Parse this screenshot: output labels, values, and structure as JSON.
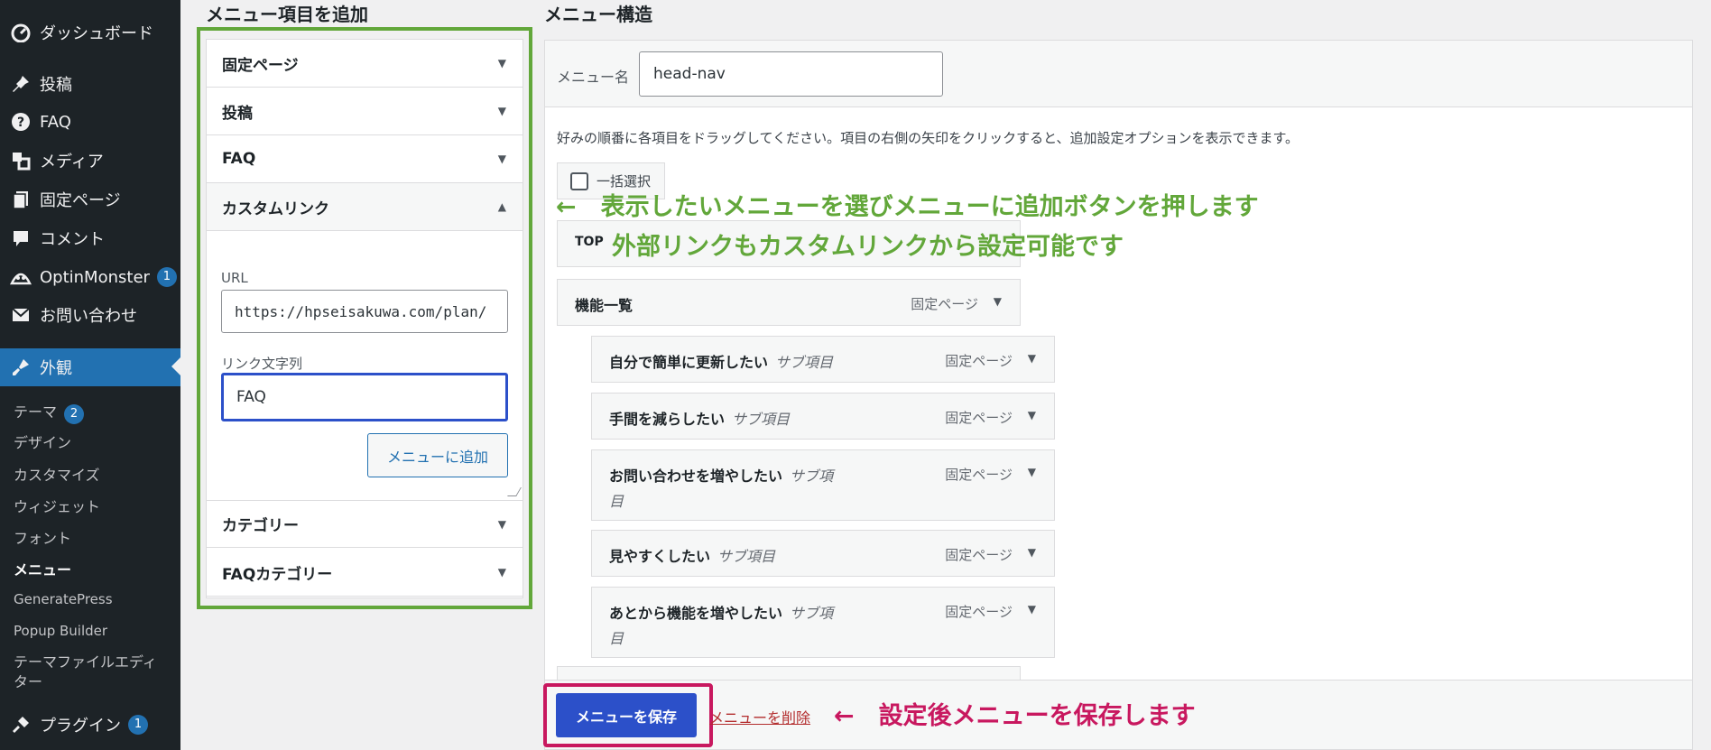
{
  "sidebar": {
    "items": [
      {
        "icon": "dashboard-icon",
        "label": "ダッシュボード"
      },
      {
        "icon": "pin-icon",
        "label": "投稿"
      },
      {
        "icon": "question-icon",
        "label": "FAQ"
      },
      {
        "icon": "media-icon",
        "label": "メディア"
      },
      {
        "icon": "page-icon",
        "label": "固定ページ"
      },
      {
        "icon": "comment-icon",
        "label": "コメント"
      },
      {
        "icon": "optinmonster-icon",
        "label": "OptinMonster",
        "badge": "1"
      },
      {
        "icon": "mail-icon",
        "label": "お問い合わせ"
      },
      {
        "icon": "appearance-icon",
        "label": "外観"
      },
      {
        "icon": "plugin-icon",
        "label": "プラグイン",
        "badge": "1"
      }
    ],
    "appearance_submenu": [
      {
        "label": "テーマ",
        "badge": "2"
      },
      {
        "label": "デザイン"
      },
      {
        "label": "カスタマイズ"
      },
      {
        "label": "ウィジェット"
      },
      {
        "label": "フォント"
      },
      {
        "label": "メニュー"
      },
      {
        "label": "GeneratePress"
      },
      {
        "label": "Popup Builder"
      },
      {
        "label": "テーマファイルエディター"
      }
    ],
    "colors": {
      "background": "#1d2327",
      "current": "#2271b1"
    }
  },
  "add_items": {
    "title": "メニュー項目を追加",
    "sections": [
      "固定ページ",
      "投稿",
      "FAQ",
      "カスタムリンク",
      "カテゴリー",
      "FAQカテゴリー"
    ],
    "custom_link": {
      "url_label": "URL",
      "url_value": "https://hpseisakuwa.com/plan/",
      "text_label": "リンク文字列",
      "text_value": "FAQ",
      "add_button": "メニューに追加"
    }
  },
  "menu_structure": {
    "title": "メニュー構造",
    "menu_name_label": "メニュー名",
    "menu_name_value": "head-nav",
    "instructions": "好みの順番に各項目をドラッグしてください。項目の右側の矢印をクリックすると、追加設定オプションを表示できます。",
    "bulk_select": "一括選択",
    "items": [
      {
        "title": "TOP",
        "sub": "",
        "type": ""
      },
      {
        "title": "機能一覧",
        "sub": "",
        "type": "固定ページ"
      },
      {
        "title": "自分で簡単に更新したい",
        "sub": "サブ項目",
        "type": "固定ページ"
      },
      {
        "title": "手間を減らしたい",
        "sub": "サブ項目",
        "type": "固定ページ"
      },
      {
        "title": "お問い合わせを増やしたい",
        "sub": "サブ項",
        "sub2": "目",
        "type": "固定ページ"
      },
      {
        "title": "見やすくしたい",
        "sub": "サブ項目",
        "type": "固定ページ"
      },
      {
        "title": "あとから機能を増やしたい",
        "sub": "サブ項",
        "sub2": "目",
        "type": "固定ページ"
      }
    ],
    "save_button": "メニューを保存",
    "delete_link": "メニューを削除"
  },
  "annotations": {
    "green_line1": "←　表示したいメニューを選びメニューに追加ボタンを押します",
    "green_line2": "外部リンクもカスタムリンクから設定可能です",
    "red_line": "←　設定後メニューを保存します",
    "green_color": "#62a73a",
    "red_color": "#c8185f"
  }
}
